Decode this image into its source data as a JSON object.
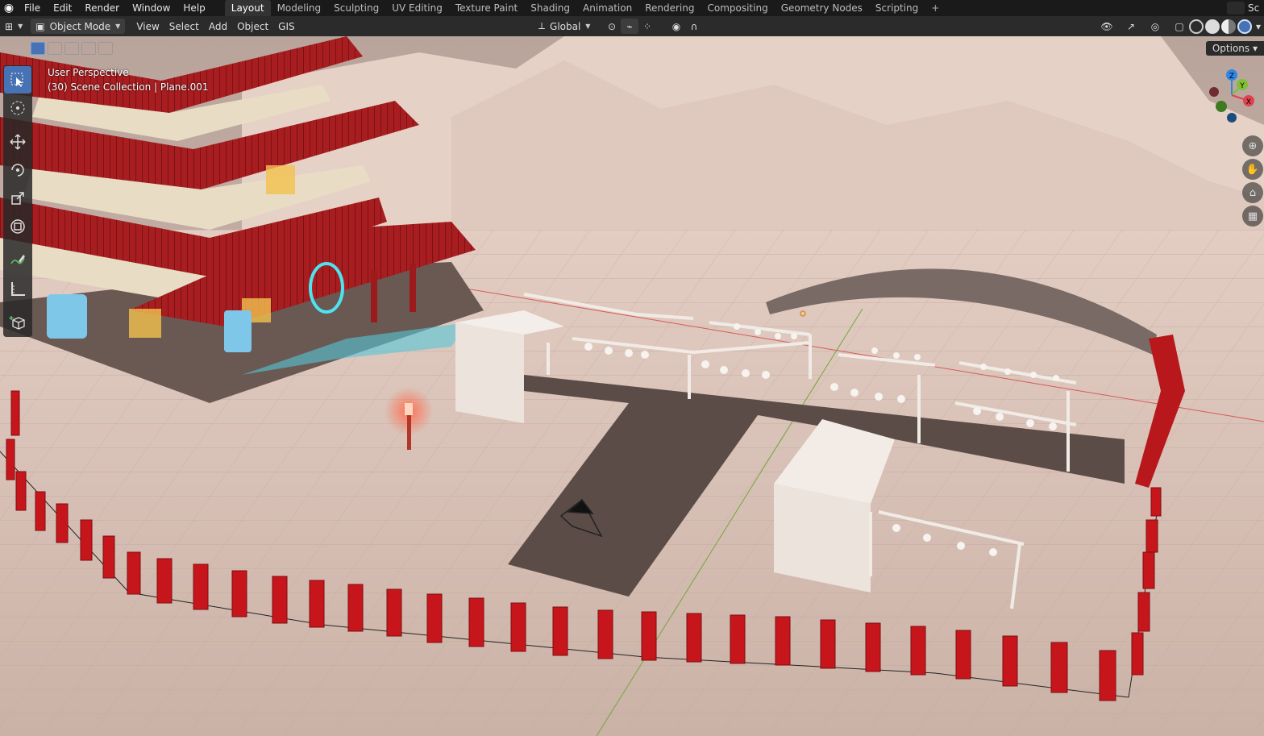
{
  "menu": [
    "File",
    "Edit",
    "Render",
    "Window",
    "Help"
  ],
  "workspaces": [
    "Layout",
    "Modeling",
    "Sculpting",
    "UV Editing",
    "Texture Paint",
    "Shading",
    "Animation",
    "Rendering",
    "Compositing",
    "Geometry Nodes",
    "Scripting"
  ],
  "active_workspace": "Layout",
  "scene_label": "Sc",
  "header": {
    "mode": "Object Mode",
    "menus": [
      "View",
      "Select",
      "Add",
      "Object",
      "GIS"
    ],
    "transform_orientation": "Global"
  },
  "viewport": {
    "perspective": "User Perspective",
    "collection": "(30) Scene Collection | Plane.001",
    "options_label": "Options",
    "gizmo_axes": [
      "Z",
      "Y",
      "X"
    ]
  },
  "tools": [
    "select-box-icon",
    "cursor-icon",
    "move-icon",
    "rotate-icon",
    "scale-icon",
    "transform-icon",
    "annotate-icon",
    "measure-icon",
    "add-cube-icon"
  ],
  "colors": {
    "accent": "#4772b3",
    "x_axis": "#e0424f",
    "y_axis": "#7fc036",
    "z_axis": "#2f86e4",
    "pillar_red": "#c6161c"
  }
}
